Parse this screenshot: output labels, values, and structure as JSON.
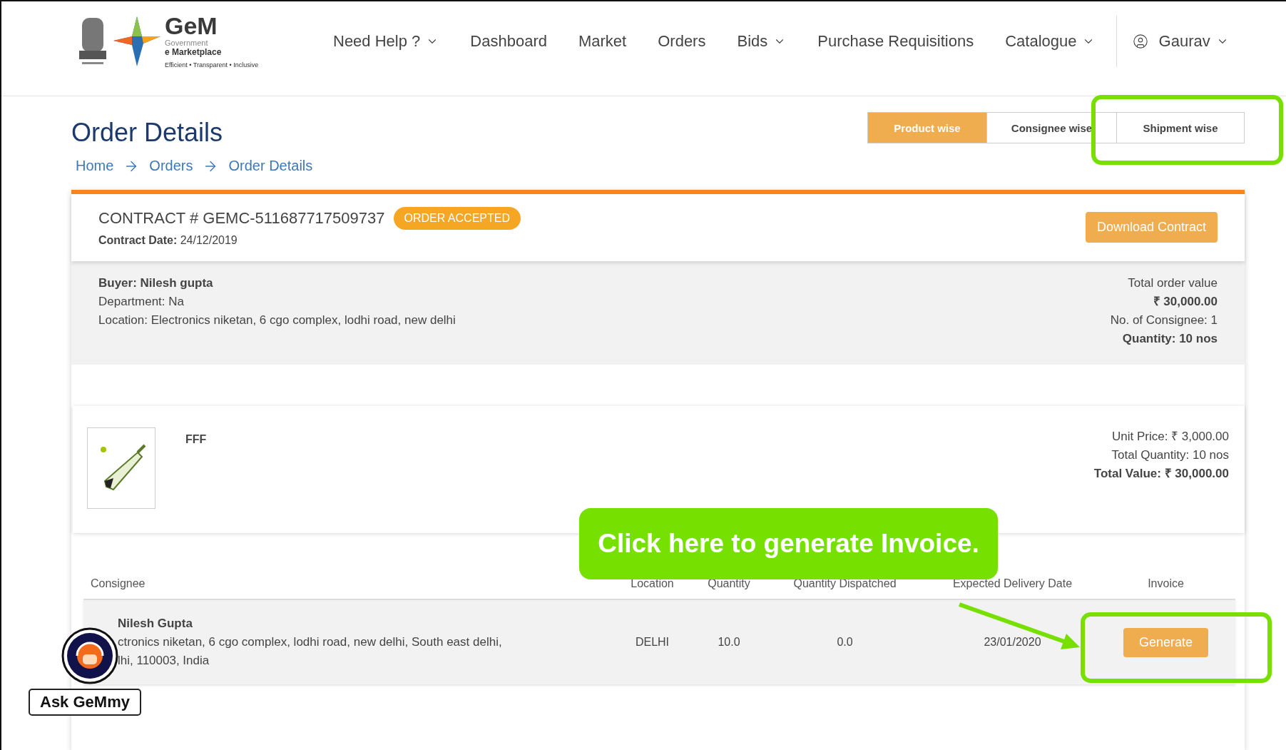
{
  "header": {
    "logo": {
      "wordmark": "GeM",
      "line_1": "Government",
      "line_2": "e Marketplace",
      "tagline": "Efficient • Transparent • Inclusive"
    },
    "nav": [
      {
        "label": "Need Help ?",
        "dropdown": true
      },
      {
        "label": "Dashboard",
        "dropdown": false
      },
      {
        "label": "Market",
        "dropdown": false
      },
      {
        "label": "Orders",
        "dropdown": false
      },
      {
        "label": "Bids",
        "dropdown": true
      },
      {
        "label": "Purchase Requisitions",
        "dropdown": false
      },
      {
        "label": "Catalogue",
        "dropdown": true
      }
    ],
    "user": {
      "name": "Gaurav",
      "dropdown": true
    }
  },
  "page": {
    "title": "Order Details",
    "breadcrumb": [
      "Home",
      "Orders",
      "Order Details"
    ]
  },
  "view_tabs": [
    {
      "label": "Product wise",
      "selected": true
    },
    {
      "label": "Consignee wise",
      "selected": false
    },
    {
      "label": "Shipment wise",
      "selected": false
    }
  ],
  "contract": {
    "number": "CONTRACT # GEMC-511687717509737",
    "status": "ORDER ACCEPTED",
    "date_label": "Contract Date:",
    "date": "24/12/2019",
    "download_button": "Download Contract"
  },
  "buyer": {
    "name": "Buyer: Nilesh gupta",
    "department": "Department: Na",
    "location": "Location: Electronics niketan, 6 cgo complex, lodhi road, new delhi",
    "total_label": "Total order value",
    "total": "₹ 30,000.00",
    "consignees": "No. of Consignee: 1",
    "quantity": "Quantity: 10 nos"
  },
  "product": {
    "name": "FFF",
    "unit_price": "Unit Price: ₹ 3,000.00",
    "total_quantity": "Total Quantity: 10 nos",
    "total_value": "Total Value: ₹ 30,000.00"
  },
  "table": {
    "columns": [
      "Consignee",
      "Location",
      "Quantity",
      "Quantity Dispatched",
      "Expected Delivery Date",
      "Invoice"
    ],
    "rows": [
      {
        "consignee": "Nilesh Gupta",
        "address": [
          "ctronics niketan, 6 cgo complex, lodhi road, new delhi, South east delhi,",
          "lhi, 110003, India"
        ],
        "location": "DELHI",
        "quantity": "10.0",
        "dispatched": "0.0",
        "delivery_date": "23/01/2020",
        "invoice_button": "Generate"
      }
    ]
  },
  "callout": "Click here to generate Invoice.",
  "chat_widget": {
    "label": "Ask GeMmy"
  }
}
